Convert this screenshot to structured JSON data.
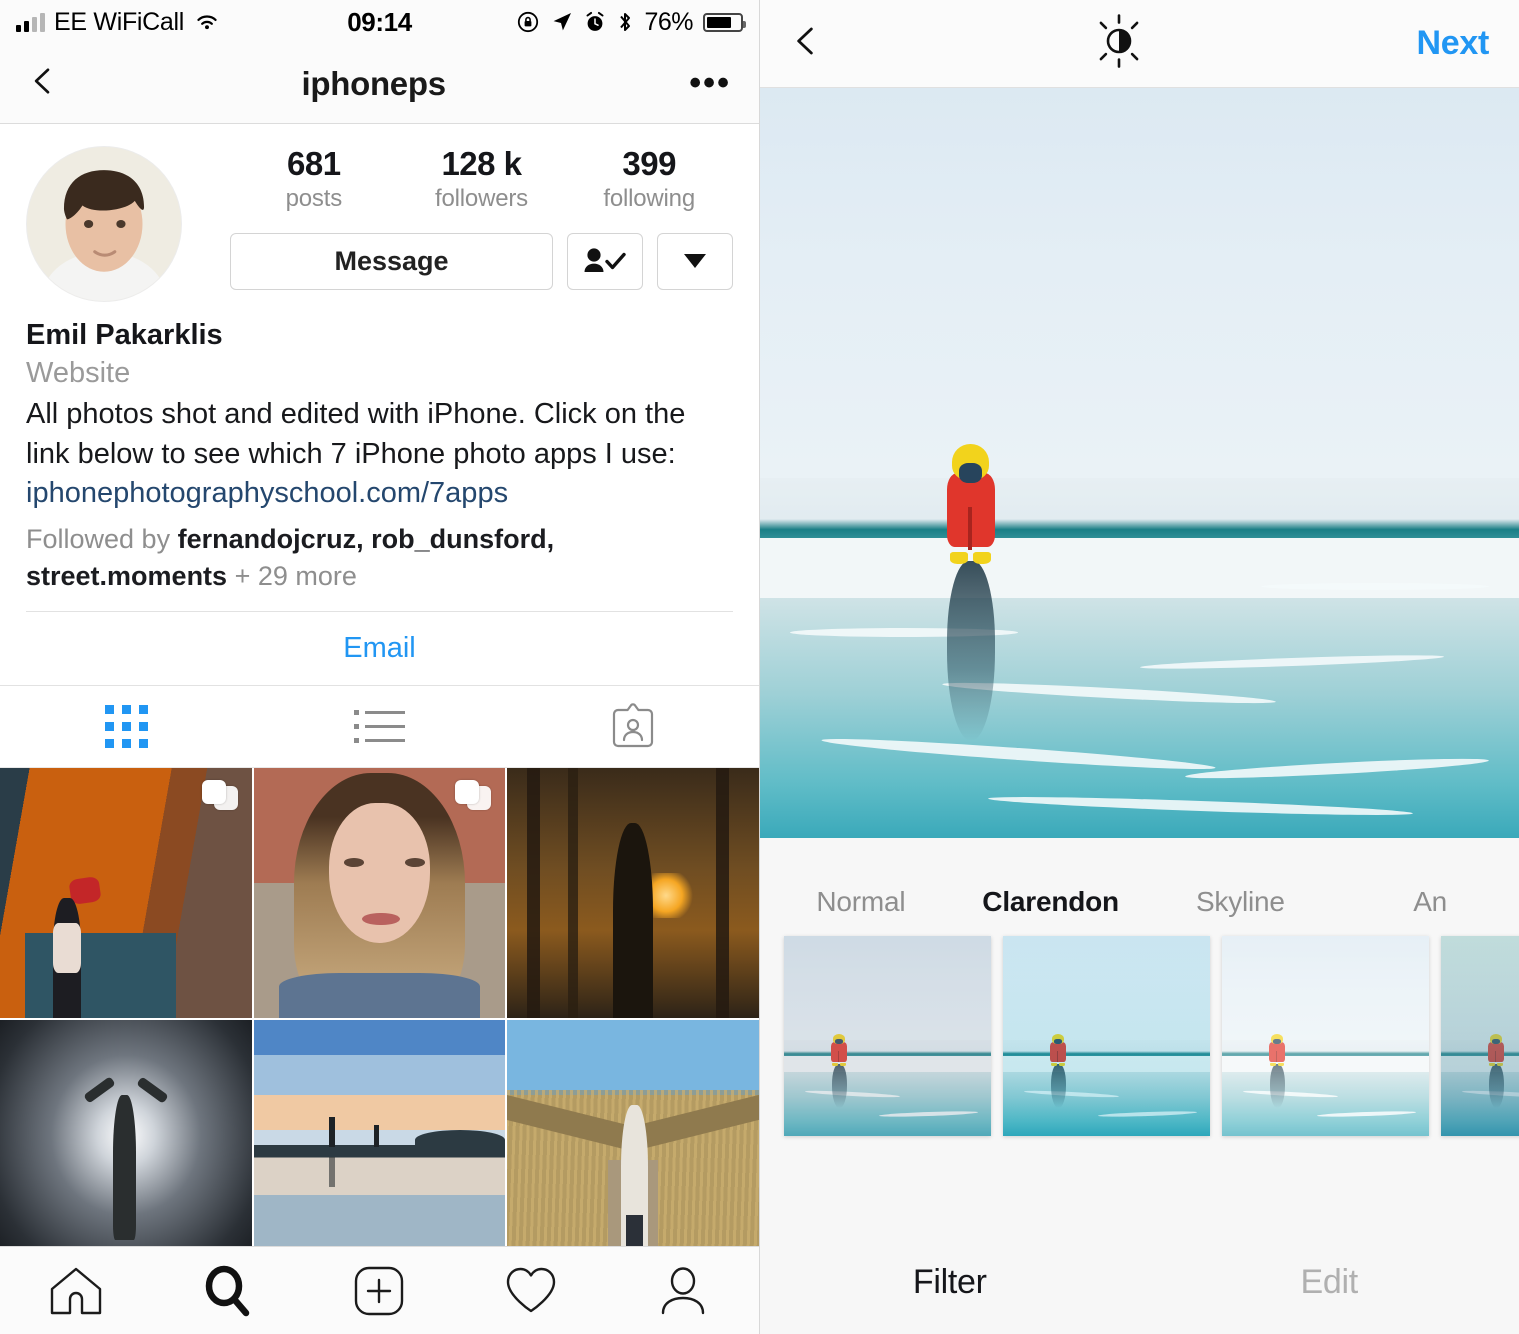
{
  "left_screen": {
    "status_bar": {
      "carrier": "EE WiFiCall",
      "time": "09:14",
      "battery_percent": "76%",
      "icons": [
        "signal-bars-icon",
        "wifi-icon",
        "rotation-lock-icon",
        "location-arrow-icon",
        "alarm-clock-icon",
        "bluetooth-icon",
        "battery-icon"
      ]
    },
    "nav_bar": {
      "back_icon": "chevron-left-icon",
      "title": "iphoneps",
      "more_icon": "ellipsis-icon"
    },
    "profile": {
      "avatar_alt": "profile-photo",
      "stats": [
        {
          "value": "681",
          "label": "posts"
        },
        {
          "value": "128 k",
          "label": "followers"
        },
        {
          "value": "399",
          "label": "following"
        }
      ],
      "message_button": "Message",
      "following_icon": "person-check-icon",
      "dropdown_icon": "triangle-down-icon",
      "full_name": "Emil Pakarklis",
      "category": "Website",
      "bio_line1": "All photos shot and edited with iPhone. Click on the",
      "bio_line2": "link below to see which 7 iPhone photo apps I use:",
      "link": "iphonephotographyschool.com/7apps",
      "followed_by_prefix": "Followed by ",
      "followed_by_names": "fernandojcruz, rob_dunsford, street.moments",
      "followed_by_suffix": " + 29 more",
      "email_button": "Email"
    },
    "tabs": [
      {
        "name": "grid-tab",
        "icon": "grid-icon",
        "active": true
      },
      {
        "name": "list-tab",
        "icon": "list-icon",
        "active": false
      },
      {
        "name": "tagged-tab",
        "icon": "tagged-photos-icon",
        "active": false
      }
    ],
    "photo_grid": [
      {
        "alt": "orange-alley-street-photo",
        "multi_post": true
      },
      {
        "alt": "blonde-woman-portrait-photo",
        "multi_post": true
      },
      {
        "alt": "forest-sunset-silhouette-photo",
        "multi_post": false
      },
      {
        "alt": "backlit-silhouette-arms-raised-photo",
        "multi_post": false
      },
      {
        "alt": "beach-reflection-clouds-photo",
        "multi_post": false
      },
      {
        "alt": "boardwalk-reeds-photo",
        "multi_post": false
      }
    ],
    "bottom_nav": [
      {
        "name": "home-tab",
        "icon": "home-icon",
        "active": false
      },
      {
        "name": "search-tab",
        "icon": "search-icon",
        "active": true
      },
      {
        "name": "add-post-tab",
        "icon": "plus-square-icon",
        "active": false
      },
      {
        "name": "activity-tab",
        "icon": "heart-icon",
        "active": false
      },
      {
        "name": "profile-tab",
        "icon": "person-icon",
        "active": false
      }
    ]
  },
  "right_screen": {
    "nav_bar": {
      "back_icon": "chevron-left-icon",
      "brightness_icon": "brightness-contrast-icon",
      "next_button": "Next"
    },
    "photo_alt": "child-in-red-suit-on-beach-photo",
    "filters": [
      {
        "label": "Normal",
        "selected": false
      },
      {
        "label": "Clarendon",
        "selected": true
      },
      {
        "label": "Skyline",
        "selected": false
      },
      {
        "label": "An",
        "selected": false
      }
    ],
    "bottom_tabs": [
      {
        "label": "Filter",
        "active": true
      },
      {
        "label": "Edit",
        "active": false
      }
    ]
  }
}
